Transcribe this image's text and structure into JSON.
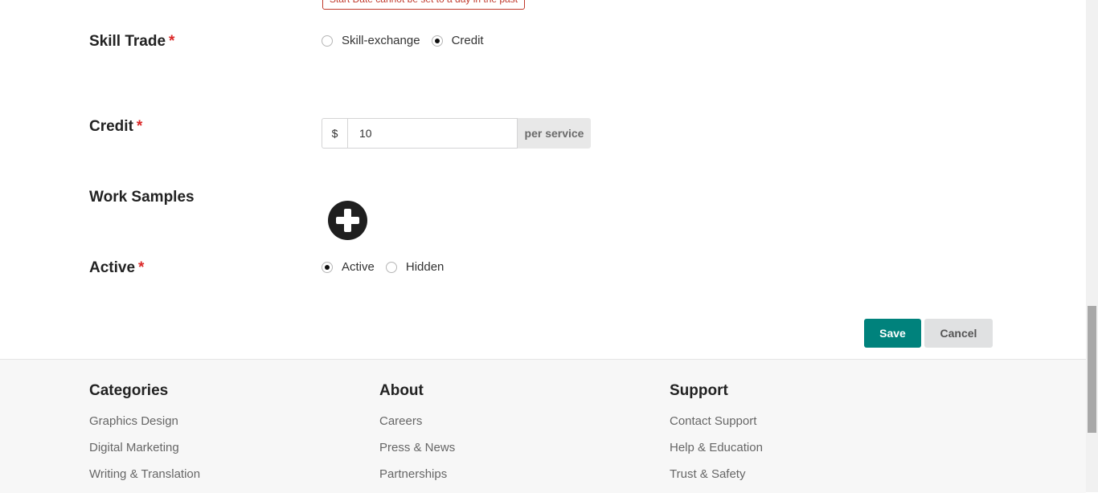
{
  "error": {
    "start_date": "Start Date cannot be set to a day in the past"
  },
  "form": {
    "skill_trade": {
      "label": "Skill Trade",
      "required": "*",
      "options": [
        "Skill-exchange",
        "Credit"
      ],
      "selected": "Credit"
    },
    "credit": {
      "label": "Credit",
      "required": "*",
      "prefix": "$",
      "value": "10",
      "suffix": "per service"
    },
    "work_samples": {
      "label": "Work Samples"
    },
    "active": {
      "label": "Active",
      "required": "*",
      "options": [
        "Active",
        "Hidden"
      ],
      "selected": "Active"
    },
    "save_label": "Save",
    "cancel_label": "Cancel"
  },
  "footer": {
    "categories": {
      "title": "Categories",
      "links": [
        "Graphics Design",
        "Digital Marketing",
        "Writing & Translation"
      ]
    },
    "about": {
      "title": "About",
      "links": [
        "Careers",
        "Press & News",
        "Partnerships"
      ]
    },
    "support": {
      "title": "Support",
      "links": [
        "Contact Support",
        "Help & Education",
        "Trust & Safety"
      ]
    }
  },
  "colors": {
    "accent": "#00827c",
    "required": "#db2828",
    "error": "#c0392b"
  }
}
